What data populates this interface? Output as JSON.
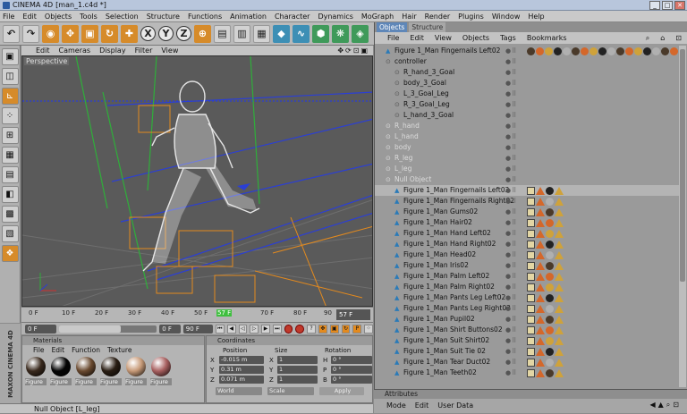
{
  "titlebar": {
    "app": "CINEMA 4D",
    "file": "[man_1.c4d *]",
    "min": "_",
    "max": "□",
    "close": "✕"
  },
  "menu": [
    "File",
    "Edit",
    "Objects",
    "Tools",
    "Selection",
    "Structure",
    "Functions",
    "Animation",
    "Character",
    "Dynamics",
    "MoGraph",
    "Hair",
    "Render",
    "Plugins",
    "Window",
    "Help"
  ],
  "toolbar": {
    "x": "X",
    "y": "Y",
    "z": "Z"
  },
  "viewport": {
    "menu": [
      "Edit",
      "Cameras",
      "Display",
      "Filter",
      "View"
    ],
    "label": "Perspective"
  },
  "timeline": {
    "ticks": [
      "0 F",
      "10 F",
      "20 F",
      "30 F",
      "40 F",
      "50 F",
      "57 F",
      "70 F",
      "80 F",
      "90"
    ],
    "current": "57 F",
    "start": "0 F",
    "cur_field": "0 F",
    "end": "90 F",
    "progress": 0.633
  },
  "materials": {
    "header": "Materials",
    "menu": [
      "File",
      "Edit",
      "Function",
      "Texture"
    ],
    "items": [
      {
        "label": "Figure",
        "color": "#3a2a1e"
      },
      {
        "label": "Figure",
        "color": "#050505"
      },
      {
        "label": "Figure",
        "color": "#6a4a30"
      },
      {
        "label": "Figure",
        "color": "#2a1e14"
      },
      {
        "label": "Figure",
        "color": "#c79a78"
      },
      {
        "label": "Figure",
        "color": "#a86060"
      }
    ]
  },
  "coordinates": {
    "header": "Coordinates",
    "cols": [
      "Position",
      "Size",
      "Rotation"
    ],
    "rows": [
      {
        "axis": "X",
        "pos": "-0.015 m",
        "size": "1",
        "rl": "H",
        "rot": "0 °"
      },
      {
        "axis": "Y",
        "pos": "0.31 m",
        "size": "1",
        "rl": "P",
        "rot": "0 °"
      },
      {
        "axis": "Z",
        "pos": "0.071 m",
        "size": "1",
        "rl": "B",
        "rot": "0 °"
      }
    ],
    "mode1": "World",
    "mode2": "Scale",
    "apply": "Apply"
  },
  "status": "Null Object [L_leg]",
  "logo": "MAXON CINEMA 4D",
  "objects": {
    "tabs": [
      "Objects",
      "Structure"
    ],
    "menu": [
      "File",
      "Edit",
      "View",
      "Objects",
      "Tags",
      "Bookmarks"
    ],
    "rows": [
      {
        "name": "Figure 1_Man Fingernails Left02",
        "indent": 8,
        "dim": false,
        "sel": false,
        "tags": "full"
      },
      {
        "name": "controller",
        "indent": 8,
        "dim": false,
        "sel": false,
        "tags": "none"
      },
      {
        "name": "R_hand_3_Goal",
        "indent": 18,
        "dim": false,
        "sel": false,
        "tags": "none"
      },
      {
        "name": "body_3_Goal",
        "indent": 18,
        "dim": false,
        "sel": false,
        "tags": "none"
      },
      {
        "name": "L_3_Goal_Leg",
        "indent": 18,
        "dim": false,
        "sel": false,
        "tags": "none"
      },
      {
        "name": "R_3_Goal_Leg",
        "indent": 18,
        "dim": false,
        "sel": false,
        "tags": "none"
      },
      {
        "name": "L_hand_3_Goal",
        "indent": 18,
        "dim": false,
        "sel": false,
        "tags": "none"
      },
      {
        "name": "R_hand",
        "indent": 8,
        "dim": true,
        "sel": false,
        "tags": "none"
      },
      {
        "name": "L_hand",
        "indent": 8,
        "dim": true,
        "sel": false,
        "tags": "none"
      },
      {
        "name": "body",
        "indent": 8,
        "dim": true,
        "sel": false,
        "tags": "none"
      },
      {
        "name": "R_leg",
        "indent": 8,
        "dim": true,
        "sel": false,
        "tags": "none"
      },
      {
        "name": "L_leg",
        "indent": 8,
        "dim": true,
        "sel": false,
        "tags": "none"
      },
      {
        "name": "Null Object",
        "indent": 8,
        "dim": true,
        "sel": false,
        "tags": "none"
      },
      {
        "name": "Figure 1_Man Fingernails Left02",
        "indent": 18,
        "dim": false,
        "sel": true,
        "tags": "fig"
      },
      {
        "name": "Figure 1_Man Fingernails Right02",
        "indent": 18,
        "dim": false,
        "sel": false,
        "tags": "fig"
      },
      {
        "name": "Figure 1_Man Gums02",
        "indent": 18,
        "dim": false,
        "sel": false,
        "tags": "fig"
      },
      {
        "name": "Figure 1_Man Hair02",
        "indent": 18,
        "dim": false,
        "sel": false,
        "tags": "fig"
      },
      {
        "name": "Figure 1_Man Hand Left02",
        "indent": 18,
        "dim": false,
        "sel": false,
        "tags": "fig"
      },
      {
        "name": "Figure 1_Man Hand Right02",
        "indent": 18,
        "dim": false,
        "sel": false,
        "tags": "fig"
      },
      {
        "name": "Figure 1_Man Head02",
        "indent": 18,
        "dim": false,
        "sel": false,
        "tags": "fig"
      },
      {
        "name": "Figure 1_Man Iris02",
        "indent": 18,
        "dim": false,
        "sel": false,
        "tags": "fig"
      },
      {
        "name": "Figure 1_Man Palm Left02",
        "indent": 18,
        "dim": false,
        "sel": false,
        "tags": "fig"
      },
      {
        "name": "Figure 1_Man Palm Right02",
        "indent": 18,
        "dim": false,
        "sel": false,
        "tags": "fig"
      },
      {
        "name": "Figure 1_Man Pants Leg Left02",
        "indent": 18,
        "dim": false,
        "sel": false,
        "tags": "fig"
      },
      {
        "name": "Figure 1_Man Pants Leg Right02",
        "indent": 18,
        "dim": false,
        "sel": false,
        "tags": "fig"
      },
      {
        "name": "Figure 1_Man Pupil02",
        "indent": 18,
        "dim": false,
        "sel": false,
        "tags": "fig"
      },
      {
        "name": "Figure 1_Man Shirt Buttons02",
        "indent": 18,
        "dim": false,
        "sel": false,
        "tags": "fig"
      },
      {
        "name": "Figure 1_Man Suit Shirt02",
        "indent": 18,
        "dim": false,
        "sel": false,
        "tags": "fig"
      },
      {
        "name": "Figure 1_Man Suit Tie 02",
        "indent": 18,
        "dim": false,
        "sel": false,
        "tags": "fig"
      },
      {
        "name": "Figure 1_Man Tear Duct02",
        "indent": 18,
        "dim": false,
        "sel": false,
        "tags": "fig"
      },
      {
        "name": "Figure 1_Man Teeth02",
        "indent": 18,
        "dim": false,
        "sel": false,
        "tags": "fig"
      }
    ]
  },
  "attributes": {
    "header": "Attributes",
    "menu": [
      "Mode",
      "Edit",
      "User Data"
    ]
  }
}
